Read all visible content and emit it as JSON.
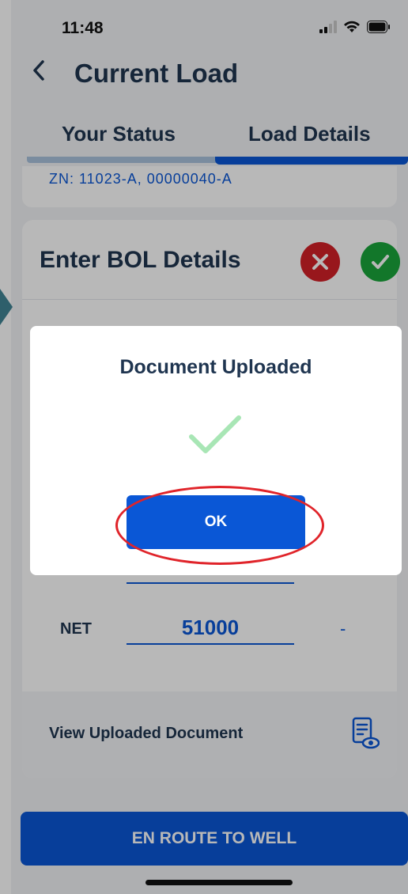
{
  "status_bar": {
    "time": "11:48"
  },
  "header": {
    "back_icon": "chevron-left-icon",
    "title": "Current Load"
  },
  "tabs": [
    {
      "label": "Your Status",
      "active": false
    },
    {
      "label": "Load Details",
      "active": true
    }
  ],
  "partial_text": "ZN: 11023-A, 00000040-A",
  "card": {
    "title": "Enter BOL Details",
    "cancel_icon": "close-icon",
    "confirm_icon": "check-icon",
    "net_label": "NET",
    "net_value": "51000",
    "net_dash": "-",
    "view_doc_label": "View Uploaded Document",
    "doc_icon": "document-view-icon"
  },
  "bottom_button": "EN ROUTE TO WELL",
  "dialog": {
    "title": "Document Uploaded",
    "icon": "check-icon",
    "ok_label": "OK"
  },
  "colors": {
    "primary": "#0a57d6",
    "title": "#1f3550",
    "danger": "#d32027",
    "success": "#1aa63b",
    "annotation": "#e0242a"
  }
}
